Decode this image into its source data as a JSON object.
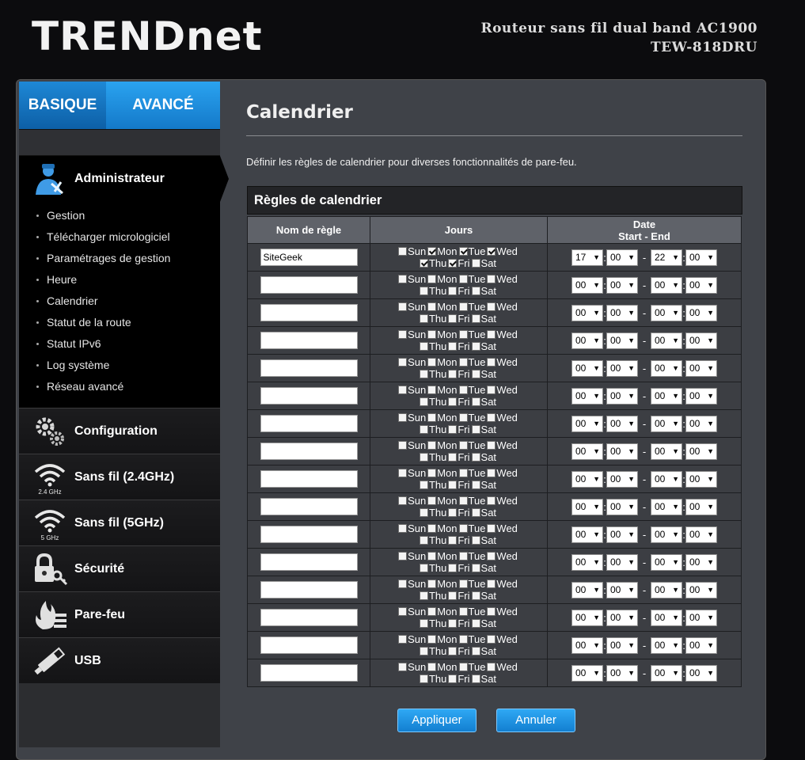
{
  "header": {
    "logo": "TRENDnet",
    "product_line1": "Routeur sans fil dual band AC1900",
    "product_line2": "TEW-818DRU"
  },
  "nav": {
    "mode_basic": "BASIQUE",
    "mode_advanced": "AVANCÉ",
    "admin": {
      "label": "Administrateur",
      "items": [
        "Gestion",
        "Télécharger micrologiciel",
        "Paramétrages de gestion",
        "Heure",
        "Calendrier",
        "Statut de la route",
        "Statut IPv6",
        "Log système",
        "Réseau avancé"
      ]
    },
    "sections": [
      {
        "label": "Configuration",
        "icon": "gears-icon",
        "sub": ""
      },
      {
        "label": "Sans fil (2.4GHz)",
        "icon": "wifi-icon",
        "sub": "2.4 GHz"
      },
      {
        "label": "Sans fil (5GHz)",
        "icon": "wifi-icon",
        "sub": "5 GHz"
      },
      {
        "label": "Sécurité",
        "icon": "lock-key-icon",
        "sub": ""
      },
      {
        "label": "Pare-feu",
        "icon": "firewall-icon",
        "sub": ""
      },
      {
        "label": "USB",
        "icon": "usb-icon",
        "sub": ""
      }
    ]
  },
  "page": {
    "title": "Calendrier",
    "description": "Définir les règles de calendrier pour diverses fonctionnalités de pare-feu.",
    "panel_title": "Règles de calendrier",
    "col_name": "Nom de règle",
    "col_days": "Jours",
    "col_date": "Date",
    "col_date_sub": "Start - End",
    "day_labels": [
      "Sun",
      "Mon",
      "Tue",
      "Wed",
      "Thu",
      "Fri",
      "Sat"
    ],
    "rules": [
      {
        "name": "SiteGeek",
        "days": [
          false,
          true,
          true,
          true,
          true,
          true,
          false
        ],
        "start_h": "17",
        "start_m": "00",
        "end_h": "22",
        "end_m": "00"
      },
      {
        "name": "",
        "days": [
          false,
          false,
          false,
          false,
          false,
          false,
          false
        ],
        "start_h": "00",
        "start_m": "00",
        "end_h": "00",
        "end_m": "00"
      },
      {
        "name": "",
        "days": [
          false,
          false,
          false,
          false,
          false,
          false,
          false
        ],
        "start_h": "00",
        "start_m": "00",
        "end_h": "00",
        "end_m": "00"
      },
      {
        "name": "",
        "days": [
          false,
          false,
          false,
          false,
          false,
          false,
          false
        ],
        "start_h": "00",
        "start_m": "00",
        "end_h": "00",
        "end_m": "00"
      },
      {
        "name": "",
        "days": [
          false,
          false,
          false,
          false,
          false,
          false,
          false
        ],
        "start_h": "00",
        "start_m": "00",
        "end_h": "00",
        "end_m": "00"
      },
      {
        "name": "",
        "days": [
          false,
          false,
          false,
          false,
          false,
          false,
          false
        ],
        "start_h": "00",
        "start_m": "00",
        "end_h": "00",
        "end_m": "00"
      },
      {
        "name": "",
        "days": [
          false,
          false,
          false,
          false,
          false,
          false,
          false
        ],
        "start_h": "00",
        "start_m": "00",
        "end_h": "00",
        "end_m": "00"
      },
      {
        "name": "",
        "days": [
          false,
          false,
          false,
          false,
          false,
          false,
          false
        ],
        "start_h": "00",
        "start_m": "00",
        "end_h": "00",
        "end_m": "00"
      },
      {
        "name": "",
        "days": [
          false,
          false,
          false,
          false,
          false,
          false,
          false
        ],
        "start_h": "00",
        "start_m": "00",
        "end_h": "00",
        "end_m": "00"
      },
      {
        "name": "",
        "days": [
          false,
          false,
          false,
          false,
          false,
          false,
          false
        ],
        "start_h": "00",
        "start_m": "00",
        "end_h": "00",
        "end_m": "00"
      },
      {
        "name": "",
        "days": [
          false,
          false,
          false,
          false,
          false,
          false,
          false
        ],
        "start_h": "00",
        "start_m": "00",
        "end_h": "00",
        "end_m": "00"
      },
      {
        "name": "",
        "days": [
          false,
          false,
          false,
          false,
          false,
          false,
          false
        ],
        "start_h": "00",
        "start_m": "00",
        "end_h": "00",
        "end_m": "00"
      },
      {
        "name": "",
        "days": [
          false,
          false,
          false,
          false,
          false,
          false,
          false
        ],
        "start_h": "00",
        "start_m": "00",
        "end_h": "00",
        "end_m": "00"
      },
      {
        "name": "",
        "days": [
          false,
          false,
          false,
          false,
          false,
          false,
          false
        ],
        "start_h": "00",
        "start_m": "00",
        "end_h": "00",
        "end_m": "00"
      },
      {
        "name": "",
        "days": [
          false,
          false,
          false,
          false,
          false,
          false,
          false
        ],
        "start_h": "00",
        "start_m": "00",
        "end_h": "00",
        "end_m": "00"
      },
      {
        "name": "",
        "days": [
          false,
          false,
          false,
          false,
          false,
          false,
          false
        ],
        "start_h": "00",
        "start_m": "00",
        "end_h": "00",
        "end_m": "00"
      }
    ],
    "apply_label": "Appliquer",
    "cancel_label": "Annuler"
  },
  "colors": {
    "accent": "#1a8ee0",
    "panel_bg": "#3f4248",
    "header_row": "#5f6269"
  }
}
